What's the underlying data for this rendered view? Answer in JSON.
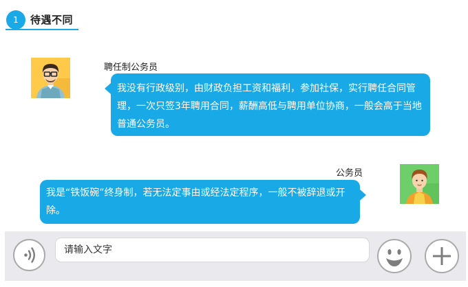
{
  "header": {
    "number": "1",
    "title": "待遇不同"
  },
  "messages": [
    {
      "sender": "聘任制公务员",
      "side": "left",
      "text": "我没有行政级别，由财政负担工资和福利，参加社保，实行聘任合同管理，一次只签3年聘用合同，薪酬高低与聘用单位协商，一般会高于当地普通公务员。"
    },
    {
      "sender": "公务员",
      "side": "right",
      "text": "我是“铁饭碗”终身制，若无法定事由或经法定程序，一般不被辞退或开除。"
    }
  ],
  "input": {
    "placeholder": "请输入文字"
  },
  "icons": [
    "voice-icon",
    "emoji-icon",
    "plus-icon"
  ],
  "colors": {
    "accent": "#19a9e6",
    "input_bar": "#eaeaee",
    "avatar_left_bg": "#ffc94a",
    "avatar_right_bg": "#6ecf6a"
  }
}
